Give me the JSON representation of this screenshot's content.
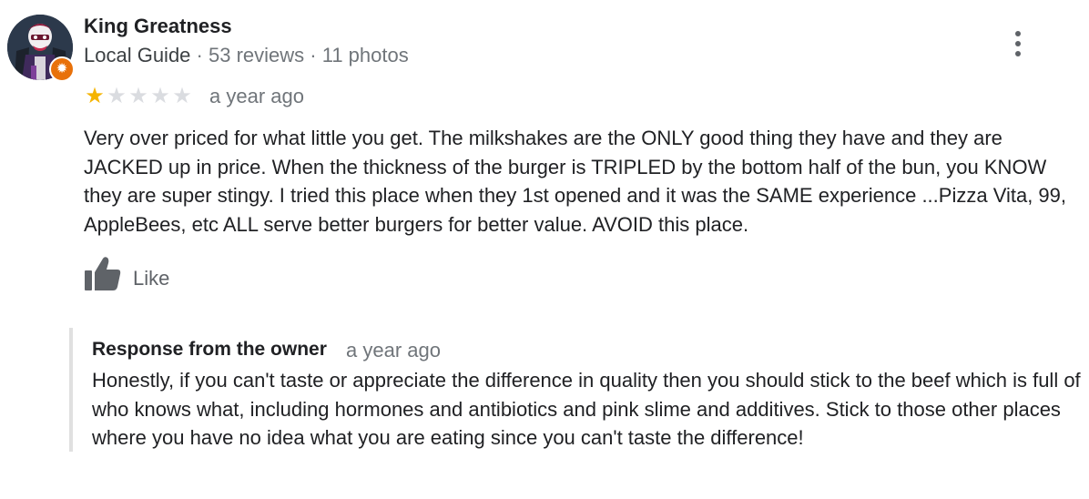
{
  "review": {
    "author": {
      "name": "King Greatness",
      "local_guide_label": "Local Guide",
      "separator": "·",
      "reviews_count": "53 reviews",
      "photos_count": "11 photos",
      "badge_icon": "star-badge-icon",
      "badge_color": "#e8710a"
    },
    "rating": 1,
    "rating_max": 5,
    "star_color": "#f5b400",
    "date": "a year ago",
    "text": "Very over priced for what little you get. The milkshakes are the ONLY good thing they have and they are JACKED up in price. When the thickness of the burger is TRIPLED by the bottom half of the bun, you KNOW they are super stingy. I tried this place when they 1st opened and it was the SAME experience ...Pizza Vita, 99, AppleBees, etc ALL serve better burgers for better value. AVOID this place.",
    "like_label": "Like",
    "like_icon": "thumbs-up-icon",
    "more_icon": "more-vertical-icon"
  },
  "owner_response": {
    "title": "Response from the owner",
    "date": "a year ago",
    "text": "Honestly, if you can't taste or appreciate the difference in quality then you should stick to the beef which is full of who knows what, including hormones and antibiotics and pink slime and additives. Stick to those other places where you have no idea what you are eating since you can't taste the difference!"
  }
}
